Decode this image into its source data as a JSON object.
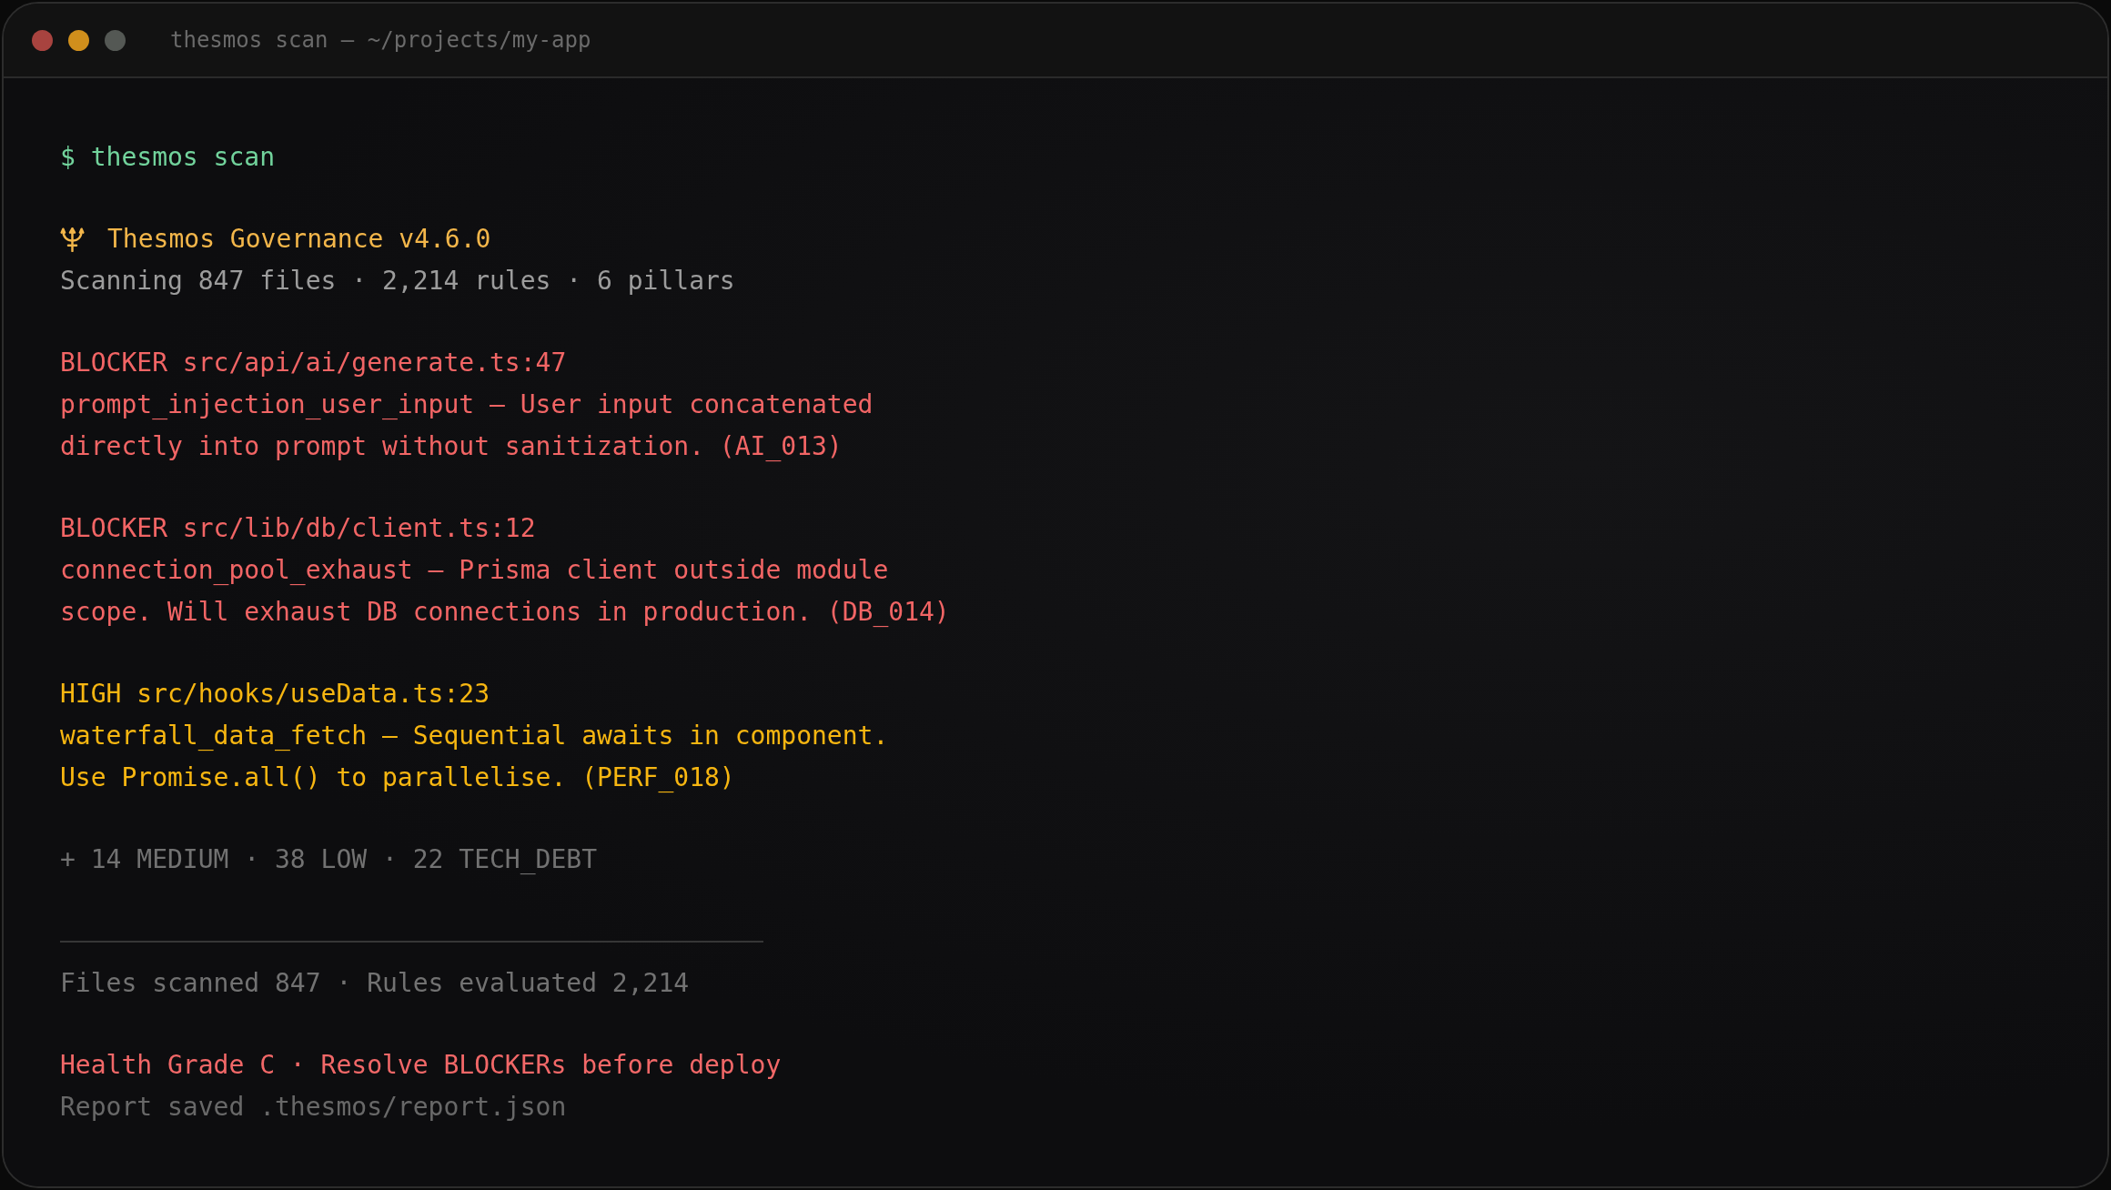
{
  "window": {
    "title": "thesmos scan — ~/projects/my-app"
  },
  "terminal": {
    "blocks": [
      {
        "lines": [
          {
            "kind": "command",
            "color": "#72d39c",
            "text": "$ thesmos scan"
          }
        ]
      },
      {
        "lines": [
          {
            "kind": "banner",
            "color": "#f3b64a",
            "text": "Thesmos Governance v4.6.0"
          },
          {
            "kind": "text",
            "color": "#9c9c9c",
            "text": "Scanning 847 files · 2,214 rules · 6 pillars"
          }
        ]
      },
      {
        "lines": [
          {
            "kind": "text",
            "color": "#f26565",
            "text": "BLOCKER src/api/ai/generate.ts:47"
          },
          {
            "kind": "text",
            "color": "#f26565",
            "text": "prompt_injection_user_input — User input concatenated"
          },
          {
            "kind": "text",
            "color": "#f26565",
            "text": "directly into prompt without sanitization. (AI_013)"
          }
        ]
      },
      {
        "lines": [
          {
            "kind": "text",
            "color": "#f26565",
            "text": "BLOCKER src/lib/db/client.ts:12"
          },
          {
            "kind": "text",
            "color": "#f26565",
            "text": "connection_pool_exhaust — Prisma client outside module"
          },
          {
            "kind": "text",
            "color": "#f26565",
            "text": "scope. Will exhaust DB connections in production. (DB_014)"
          }
        ]
      },
      {
        "lines": [
          {
            "kind": "text",
            "color": "#f7b611",
            "text": "HIGH src/hooks/useData.ts:23"
          },
          {
            "kind": "text",
            "color": "#f7b611",
            "text": "waterfall_data_fetch — Sequential awaits in component."
          },
          {
            "kind": "text",
            "color": "#f7b611",
            "text": "Use Promise.all() to parallelise. (PERF_018)"
          }
        ]
      },
      {
        "lines": [
          {
            "kind": "text",
            "color": "#727272",
            "text": "+ 14 MEDIUM · 38 LOW · 22 TECH_DEBT"
          }
        ]
      },
      {
        "lines": [
          {
            "kind": "rule"
          },
          {
            "kind": "text",
            "color": "#727272",
            "text": "Files scanned 847 · Rules evaluated 2,214"
          }
        ]
      },
      {
        "lines": [
          {
            "kind": "text",
            "color": "#f26868",
            "text": "Health Grade C · Resolve BLOCKERs before deploy"
          },
          {
            "kind": "text",
            "color": "#686868",
            "text": "Report saved .thesmos/report.json"
          }
        ]
      }
    ]
  }
}
